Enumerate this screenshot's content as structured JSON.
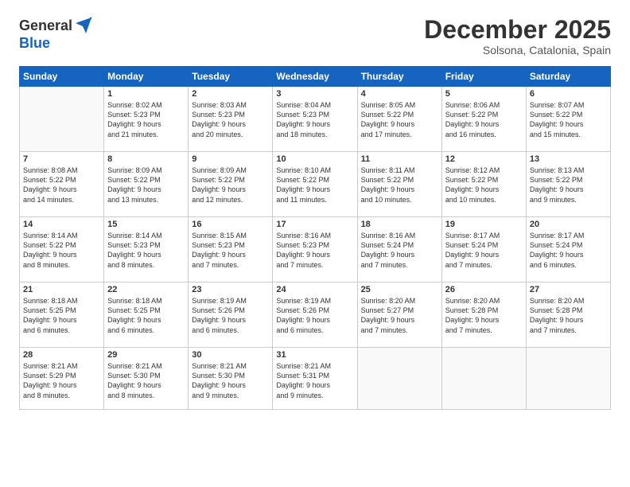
{
  "logo": {
    "general": "General",
    "blue": "Blue"
  },
  "header": {
    "month": "December 2025",
    "location": "Solsona, Catalonia, Spain"
  },
  "weekdays": [
    "Sunday",
    "Monday",
    "Tuesday",
    "Wednesday",
    "Thursday",
    "Friday",
    "Saturday"
  ],
  "weeks": [
    [
      {
        "day": "",
        "info": "",
        "empty": true
      },
      {
        "day": "1",
        "info": "Sunrise: 8:02 AM\nSunset: 5:23 PM\nDaylight: 9 hours\nand 21 minutes."
      },
      {
        "day": "2",
        "info": "Sunrise: 8:03 AM\nSunset: 5:23 PM\nDaylight: 9 hours\nand 20 minutes."
      },
      {
        "day": "3",
        "info": "Sunrise: 8:04 AM\nSunset: 5:23 PM\nDaylight: 9 hours\nand 18 minutes."
      },
      {
        "day": "4",
        "info": "Sunrise: 8:05 AM\nSunset: 5:22 PM\nDaylight: 9 hours\nand 17 minutes."
      },
      {
        "day": "5",
        "info": "Sunrise: 8:06 AM\nSunset: 5:22 PM\nDaylight: 9 hours\nand 16 minutes."
      },
      {
        "day": "6",
        "info": "Sunrise: 8:07 AM\nSunset: 5:22 PM\nDaylight: 9 hours\nand 15 minutes."
      }
    ],
    [
      {
        "day": "7",
        "info": "Sunrise: 8:08 AM\nSunset: 5:22 PM\nDaylight: 9 hours\nand 14 minutes."
      },
      {
        "day": "8",
        "info": "Sunrise: 8:09 AM\nSunset: 5:22 PM\nDaylight: 9 hours\nand 13 minutes."
      },
      {
        "day": "9",
        "info": "Sunrise: 8:09 AM\nSunset: 5:22 PM\nDaylight: 9 hours\nand 12 minutes."
      },
      {
        "day": "10",
        "info": "Sunrise: 8:10 AM\nSunset: 5:22 PM\nDaylight: 9 hours\nand 11 minutes."
      },
      {
        "day": "11",
        "info": "Sunrise: 8:11 AM\nSunset: 5:22 PM\nDaylight: 9 hours\nand 10 minutes."
      },
      {
        "day": "12",
        "info": "Sunrise: 8:12 AM\nSunset: 5:22 PM\nDaylight: 9 hours\nand 10 minutes."
      },
      {
        "day": "13",
        "info": "Sunrise: 8:13 AM\nSunset: 5:22 PM\nDaylight: 9 hours\nand 9 minutes."
      }
    ],
    [
      {
        "day": "14",
        "info": "Sunrise: 8:14 AM\nSunset: 5:22 PM\nDaylight: 9 hours\nand 8 minutes."
      },
      {
        "day": "15",
        "info": "Sunrise: 8:14 AM\nSunset: 5:23 PM\nDaylight: 9 hours\nand 8 minutes."
      },
      {
        "day": "16",
        "info": "Sunrise: 8:15 AM\nSunset: 5:23 PM\nDaylight: 9 hours\nand 7 minutes."
      },
      {
        "day": "17",
        "info": "Sunrise: 8:16 AM\nSunset: 5:23 PM\nDaylight: 9 hours\nand 7 minutes."
      },
      {
        "day": "18",
        "info": "Sunrise: 8:16 AM\nSunset: 5:24 PM\nDaylight: 9 hours\nand 7 minutes."
      },
      {
        "day": "19",
        "info": "Sunrise: 8:17 AM\nSunset: 5:24 PM\nDaylight: 9 hours\nand 7 minutes."
      },
      {
        "day": "20",
        "info": "Sunrise: 8:17 AM\nSunset: 5:24 PM\nDaylight: 9 hours\nand 6 minutes."
      }
    ],
    [
      {
        "day": "21",
        "info": "Sunrise: 8:18 AM\nSunset: 5:25 PM\nDaylight: 9 hours\nand 6 minutes."
      },
      {
        "day": "22",
        "info": "Sunrise: 8:18 AM\nSunset: 5:25 PM\nDaylight: 9 hours\nand 6 minutes."
      },
      {
        "day": "23",
        "info": "Sunrise: 8:19 AM\nSunset: 5:26 PM\nDaylight: 9 hours\nand 6 minutes."
      },
      {
        "day": "24",
        "info": "Sunrise: 8:19 AM\nSunset: 5:26 PM\nDaylight: 9 hours\nand 6 minutes."
      },
      {
        "day": "25",
        "info": "Sunrise: 8:20 AM\nSunset: 5:27 PM\nDaylight: 9 hours\nand 7 minutes."
      },
      {
        "day": "26",
        "info": "Sunrise: 8:20 AM\nSunset: 5:28 PM\nDaylight: 9 hours\nand 7 minutes."
      },
      {
        "day": "27",
        "info": "Sunrise: 8:20 AM\nSunset: 5:28 PM\nDaylight: 9 hours\nand 7 minutes."
      }
    ],
    [
      {
        "day": "28",
        "info": "Sunrise: 8:21 AM\nSunset: 5:29 PM\nDaylight: 9 hours\nand 8 minutes."
      },
      {
        "day": "29",
        "info": "Sunrise: 8:21 AM\nSunset: 5:30 PM\nDaylight: 9 hours\nand 8 minutes."
      },
      {
        "day": "30",
        "info": "Sunrise: 8:21 AM\nSunset: 5:30 PM\nDaylight: 9 hours\nand 9 minutes."
      },
      {
        "day": "31",
        "info": "Sunrise: 8:21 AM\nSunset: 5:31 PM\nDaylight: 9 hours\nand 9 minutes."
      },
      {
        "day": "",
        "info": "",
        "empty": true
      },
      {
        "day": "",
        "info": "",
        "empty": true
      },
      {
        "day": "",
        "info": "",
        "empty": true
      }
    ]
  ]
}
